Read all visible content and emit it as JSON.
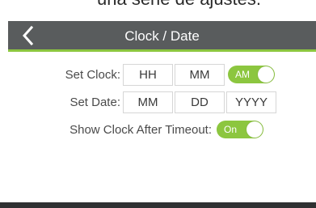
{
  "caption": "una serie de ajustes.",
  "header": {
    "title": "Clock / Date",
    "back_icon": "chevron-left-icon"
  },
  "clock": {
    "label": "Set Clock:",
    "hour_placeholder": "HH",
    "minute_placeholder": "MM",
    "ampm_label": "AM"
  },
  "date": {
    "label": "Set Date:",
    "month_placeholder": "MM",
    "day_placeholder": "DD",
    "year_placeholder": "YYYY"
  },
  "timeout": {
    "label": "Show Clock After Timeout:",
    "toggle_label": "On"
  },
  "colors": {
    "accent": "#8cc63f",
    "header_bg": "#595c5d"
  }
}
